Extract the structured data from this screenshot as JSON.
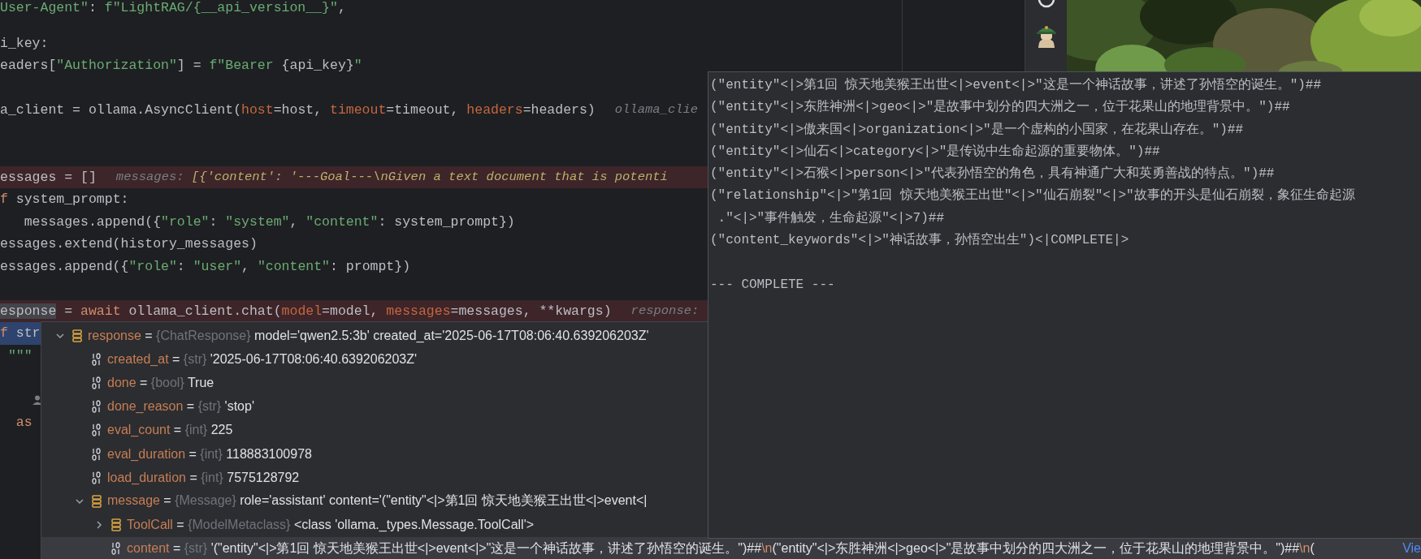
{
  "editor": {
    "lines": [
      {
        "kind": "code",
        "breakpoint": false,
        "current": false,
        "code": [
          {
            "t": "User-Agent\"",
            "kind": "string"
          },
          {
            "t": ": ",
            "kind": "plain"
          },
          {
            "t": "f\"LightRAG/{__api_version__}\"",
            "kind": "string"
          },
          {
            "t": ",",
            "kind": "plain"
          }
        ]
      },
      {
        "kind": "blank"
      },
      {
        "kind": "code",
        "breakpoint": false,
        "current": false,
        "code": [
          {
            "t": "i_key:",
            "kind": "plain"
          }
        ]
      },
      {
        "kind": "code",
        "breakpoint": false,
        "current": false,
        "code": [
          {
            "t": "eaders[",
            "kind": "plain"
          },
          {
            "t": "\"Authorization\"",
            "kind": "string"
          },
          {
            "t": "] = ",
            "kind": "plain"
          },
          {
            "t": "f\"Bearer ",
            "kind": "string"
          },
          {
            "t": "{api_key}",
            "kind": "plain"
          },
          {
            "t": "\"",
            "kind": "string"
          }
        ]
      },
      {
        "kind": "blank"
      },
      {
        "kind": "code",
        "breakpoint": false,
        "current": false,
        "code": [
          {
            "t": "a_client = ollama.AsyncClient(",
            "kind": "plain"
          },
          {
            "t": "host",
            "kind": "param"
          },
          {
            "t": "=host, ",
            "kind": "plain"
          },
          {
            "t": "timeout",
            "kind": "param"
          },
          {
            "t": "=timeout, ",
            "kind": "plain"
          },
          {
            "t": "headers",
            "kind": "param"
          },
          {
            "t": "=headers)",
            "kind": "plain"
          }
        ],
        "hint": [
          {
            "t": "ollama_clie",
            "kind": "hint_label"
          }
        ]
      },
      {
        "kind": "blank"
      },
      {
        "kind": "blank"
      },
      {
        "kind": "code",
        "breakpoint": true,
        "current": false,
        "code": [
          {
            "t": "essages = []",
            "kind": "plain"
          }
        ],
        "hint": [
          {
            "t": "messages: ",
            "kind": "hint_label"
          },
          {
            "t": "[{'content': '---Goal---\\nGiven a text document that is potenti",
            "kind": "hint_value"
          }
        ]
      },
      {
        "kind": "code",
        "breakpoint": false,
        "current": false,
        "code": [
          {
            "t": "f",
            "kind": "keyword"
          },
          {
            "t": " system_prompt:",
            "kind": "plain"
          }
        ]
      },
      {
        "kind": "code",
        "breakpoint": false,
        "current": false,
        "code": [
          {
            "t": "   messages.append({",
            "kind": "plain"
          },
          {
            "t": "\"role\"",
            "kind": "string"
          },
          {
            "t": ": ",
            "kind": "plain"
          },
          {
            "t": "\"system\"",
            "kind": "string"
          },
          {
            "t": ", ",
            "kind": "plain"
          },
          {
            "t": "\"content\"",
            "kind": "string"
          },
          {
            "t": ": system_prompt})",
            "kind": "plain"
          }
        ]
      },
      {
        "kind": "code",
        "breakpoint": false,
        "current": false,
        "code": [
          {
            "t": "essages.extend(history_messages)",
            "kind": "plain"
          }
        ]
      },
      {
        "kind": "code",
        "breakpoint": false,
        "current": false,
        "code": [
          {
            "t": "essages.append({",
            "kind": "plain"
          },
          {
            "t": "\"role\"",
            "kind": "string"
          },
          {
            "t": ": ",
            "kind": "plain"
          },
          {
            "t": "\"user\"",
            "kind": "string"
          },
          {
            "t": ", ",
            "kind": "plain"
          },
          {
            "t": "\"content\"",
            "kind": "string"
          },
          {
            "t": ": prompt})",
            "kind": "plain"
          }
        ]
      },
      {
        "kind": "blank"
      },
      {
        "kind": "code",
        "breakpoint": true,
        "current": false,
        "code": [
          {
            "t": "esponse",
            "kind": "selected"
          },
          {
            "t": " = ",
            "kind": "plain"
          },
          {
            "t": "await",
            "kind": "keyword"
          },
          {
            "t": " ollama_client.chat(",
            "kind": "plain"
          },
          {
            "t": "model",
            "kind": "param"
          },
          {
            "t": "=model, ",
            "kind": "plain"
          },
          {
            "t": "messages",
            "kind": "param"
          },
          {
            "t": "=messages, **kwargs)",
            "kind": "plain"
          }
        ],
        "hint": [
          {
            "t": "response:",
            "kind": "hint_label"
          }
        ]
      },
      {
        "kind": "code",
        "breakpoint": false,
        "current": true,
        "code": [
          {
            "t": "f",
            "kind": "keyword"
          },
          {
            "t": " str",
            "kind": "plain"
          }
        ]
      },
      {
        "kind": "code",
        "breakpoint": false,
        "current": false,
        "code": [
          {
            "t": " \"\"\"",
            "kind": "string"
          }
        ]
      },
      {
        "kind": "blank"
      },
      {
        "kind": "author"
      },
      {
        "kind": "code",
        "breakpoint": false,
        "current": false,
        "code": [
          {
            "t": "  as",
            "kind": "keyword"
          }
        ]
      }
    ]
  },
  "debugger_tree": {
    "rows": [
      {
        "name": "response",
        "sep": "=",
        "type": "{ChatResponse}",
        "value": "model='qwen2.5:3b' created_at='2025-06-17T08:06:40.639206203Z'",
        "kind": "object",
        "expanded": true,
        "selected": false,
        "children": [
          {
            "name": "created_at",
            "sep": "=",
            "type": "{str}",
            "value": "'2025-06-17T08:06:40.639206203Z'",
            "kind": "primitive",
            "selected": false
          },
          {
            "name": "done",
            "sep": "=",
            "type": "{bool}",
            "value": "True",
            "kind": "primitive",
            "selected": false
          },
          {
            "name": "done_reason",
            "sep": "=",
            "type": "{str}",
            "value": "'stop'",
            "kind": "primitive",
            "selected": false
          },
          {
            "name": "eval_count",
            "sep": "=",
            "type": "{int}",
            "value": "225",
            "kind": "primitive",
            "selected": false
          },
          {
            "name": "eval_duration",
            "sep": "=",
            "type": "{int}",
            "value": "118883100978",
            "kind": "primitive",
            "selected": false
          },
          {
            "name": "load_duration",
            "sep": "=",
            "type": "{int}",
            "value": "7575128792",
            "kind": "primitive",
            "selected": false
          },
          {
            "name": "message",
            "sep": "=",
            "type": "{Message}",
            "value": "role='assistant' content='(\"entity\"<|>第1回 惊天地美猴王出世<|>event<|",
            "kind": "object",
            "expanded": true,
            "selected": false,
            "children": [
              {
                "name": "ToolCall",
                "sep": "=",
                "type": "{ModelMetaclass}",
                "value": "<class 'ollama._types.Message.ToolCall'>",
                "kind": "object",
                "expanded": false,
                "selected": false
              },
              {
                "name": "content",
                "sep": "=",
                "type": "{str}",
                "value_parts": [
                  {
                    "t": "'(\"entity\"<|>第1回 惊天地美猴王出世<|>event<|>\"这是一个神话故事，讲述了孙悟空的诞生。\")##",
                    "kind": "plain"
                  },
                  {
                    "t": "\\n",
                    "kind": "escape"
                  },
                  {
                    "t": "(\"entity\"<|>东胜神洲<|>geo<|>\"是故事中划分的四大洲之一，位于花果山的地理背景中。\")##",
                    "kind": "plain"
                  },
                  {
                    "t": "\\n",
                    "kind": "escape"
                  },
                  {
                    "t": "(",
                    "kind": "plain"
                  }
                ],
                "link": "Vie",
                "kind": "primitive",
                "selected": true
              }
            ]
          }
        ]
      }
    ]
  },
  "value_popup": {
    "lines": [
      "(\"entity\"<|>第1回 惊天地美猴王出世<|>event<|>\"这是一个神话故事，讲述了孙悟空的诞生。\")##",
      "(\"entity\"<|>东胜神洲<|>geo<|>\"是故事中划分的四大洲之一，位于花果山的地理背景中。\")##",
      "(\"entity\"<|>傲来国<|>organization<|>\"是一个虚构的小国家，在花果山存在。\")##",
      "(\"entity\"<|>仙石<|>category<|>\"是传说中生命起源的重要物体。\")##",
      "(\"entity\"<|>石猴<|>person<|>\"代表孙悟空的角色，具有神通广大和英勇善战的特点。\")##",
      "(\"relationship\"<|>\"第1回 惊天地美猴王出世\"<|>\"仙石崩裂\"<|>\"故事的开头是仙石崩裂，象征生命起源",
      " .\"<|>\"事件触发，生命起源\"<|>7)##",
      "(\"content_keywords\"<|>\"神话故事，孙悟空出生\")<|COMPLETE|>"
    ],
    "footer": "--- COMPLETE ---"
  }
}
